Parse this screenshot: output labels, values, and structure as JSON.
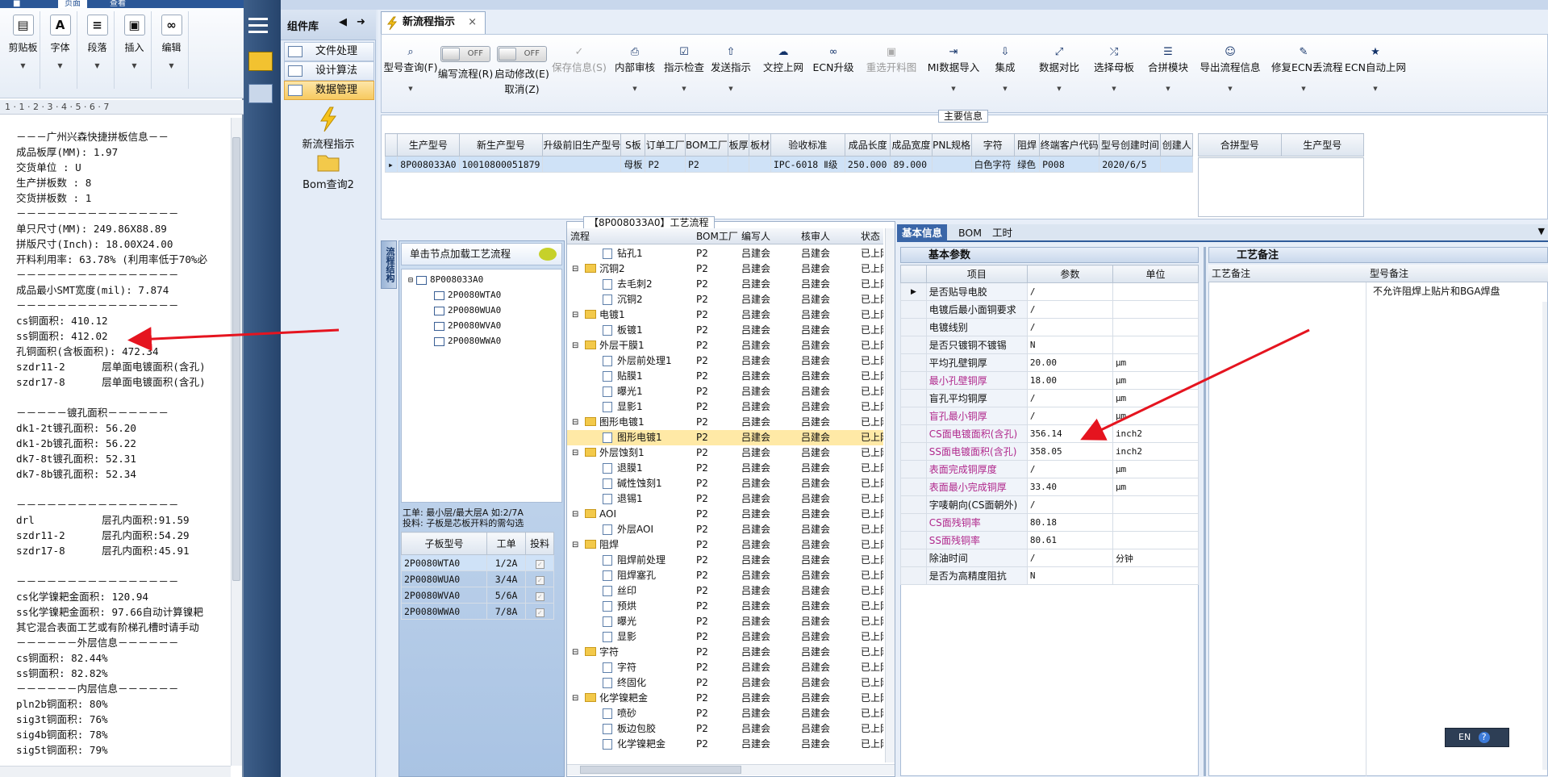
{
  "left_window": {
    "tabs": [
      "页面",
      "查看"
    ],
    "ribbon": [
      {
        "label": "剪贴板",
        "icon": "clipboard-icon"
      },
      {
        "label": "字体",
        "icon": "font-icon"
      },
      {
        "label": "段落",
        "icon": "paragraph-icon"
      },
      {
        "label": "插入",
        "icon": "insert-image-icon"
      },
      {
        "label": "编辑",
        "icon": "binoculars-icon"
      }
    ],
    "ruler": "1 · 1 · 2 · 3 · 4 · 5 · 6 · 7",
    "lines": [
      "－－－广州兴森快捷拼板信息－－",
      "成品板厚(MM): 1.97",
      "交货单位 : U",
      "生产拼板数 : 8",
      "交货拼板数 : 1",
      "－－－－－－－－－－－－－－－－",
      "单只尺寸(MM): 249.86X88.89",
      "拼版尺寸(Inch): 18.00X24.00",
      "开料利用率: 63.78% (利用率低于70%必",
      "－－－－－－－－－－－－－－－－",
      "成品最小SMT宽度(mil): 7.874",
      "－－－－－－－－－－－－－－－－",
      "cs铜面积: 410.12",
      "ss铜面积: 412.02",
      "孔铜面积(含板面积): 472.34",
      "szdr11-2      层单面电镀面积(含孔)",
      "szdr17-8      层单面电镀面积(含孔)",
      "",
      "－－－－－镀孔面积－－－－－－",
      "dk1-2t镀孔面积: 56.20",
      "dk1-2b镀孔面积: 56.22",
      "dk7-8t镀孔面积: 52.31",
      "dk7-8b镀孔面积: 52.34",
      "",
      "－－－－－－－－－－－－－－－－",
      "drl           层孔内面积:91.59",
      "szdr11-2      层孔内面积:54.29",
      "szdr17-8      层孔内面积:45.91",
      "",
      "－－－－－－－－－－－－－－－－",
      "cs化学镍耙金面积: 120.94",
      "ss化学镍耙金面积: 97.66自动计算镍耙",
      "其它混合表面工艺或有阶梯孔槽时请手动",
      "－－－－－－外层信息－－－－－－",
      "cs铜面积: 82.44%",
      "ss铜面积: 82.82%",
      "－－－－－－内层信息－－－－－－",
      "pln2b铜面积: 80%",
      "sig3t铜面积: 76%",
      "sig4b铜面积: 78%",
      "sig5t铜面积: 79%"
    ]
  },
  "component_lib": {
    "title": "组件库",
    "items": [
      "文件处理",
      "设计算法",
      "数据管理"
    ],
    "big_buttons": [
      "新流程指示",
      "Bom查询2"
    ]
  },
  "doc_tab": {
    "label": "新流程指示",
    "close": "×"
  },
  "toolbar": {
    "buttons": [
      {
        "label": "型号查询(F)",
        "icon": "search-icon",
        "disabled": false
      },
      {
        "label": "编写流程(R)",
        "icon": "",
        "disabled": false
      },
      {
        "label": "启动修改(E)",
        "sub": "取消(Z)",
        "icon": "",
        "disabled": false
      },
      {
        "label": "保存信息(S)",
        "icon": "check-icon",
        "disabled": true
      },
      {
        "label": "内部审核",
        "icon": "print-icon",
        "disabled": false
      },
      {
        "label": "指示检查",
        "icon": "checkbox-icon",
        "disabled": false
      },
      {
        "label": "发送指示",
        "icon": "upload-icon",
        "disabled": false
      },
      {
        "label": "文控上网",
        "icon": "cloud-upload-icon",
        "disabled": false
      },
      {
        "label": "ECN升级",
        "icon": "binoculars-icon",
        "disabled": false
      },
      {
        "label": "重选开料图",
        "icon": "image-icon",
        "disabled": true
      },
      {
        "label": "MI数据导入",
        "icon": "import-icon",
        "disabled": false
      },
      {
        "label": "集成",
        "icon": "download-icon",
        "disabled": false
      },
      {
        "label": "数据对比",
        "icon": "compare-icon",
        "disabled": false
      },
      {
        "label": "选择母板",
        "icon": "shuffle-icon",
        "disabled": false
      },
      {
        "label": "合拼模块",
        "icon": "list-icon",
        "disabled": false
      },
      {
        "label": "导出流程信息",
        "icon": "smile-icon",
        "disabled": false
      },
      {
        "label": "修复ECN丢流程",
        "icon": "wrench-icon",
        "disabled": false
      },
      {
        "label": "ECN自动上网",
        "icon": "star-icon",
        "disabled": false
      }
    ],
    "toggle_off": "OFF"
  },
  "main_info": {
    "caption": "主要信息",
    "columns": [
      "生产型号",
      "新生产型号",
      "升级前旧生产型号",
      "S板",
      "订单工厂",
      "BOM工厂",
      "板厚",
      "板材",
      "验收标准",
      "成品长度",
      "成品宽度",
      "PNL规格",
      "字符",
      "阻焊",
      "终端客户代码",
      "型号创建时间",
      "创建人"
    ],
    "row": [
      "8P008033A0",
      "10010800051879",
      "",
      "母板",
      "P2",
      "P2",
      "",
      "",
      "IPC-6018 Ⅱ级",
      "250.000",
      "89.000",
      "",
      "白色字符",
      "绿色",
      "P008",
      "2020/6/5",
      ""
    ],
    "side_columns": [
      "合拼型号",
      "生产型号"
    ]
  },
  "structure": {
    "vtab": "流程结构",
    "hint": "单击节点加载工艺流程",
    "root": "8P008033A0",
    "children": [
      "2P0080WTA0",
      "2P0080WUA0",
      "2P0080WVA0",
      "2P0080WWA0"
    ],
    "note1": "工单: 最小层/最大层A 如:2/7A",
    "note2": "投料: 子板是芯板开料的需勾选",
    "sub_columns": [
      "子板型号",
      "工单",
      "投料"
    ],
    "sub_rows": [
      [
        "2P0080WTA0",
        "1/2A"
      ],
      [
        "2P0080WUA0",
        "3/4A"
      ],
      [
        "2P0080WVA0",
        "5/6A"
      ],
      [
        "2P0080WWA0",
        "7/8A"
      ]
    ]
  },
  "flow": {
    "caption": "【8P008033A0】工艺流程",
    "columns": [
      "流程",
      "BOM工厂",
      "编写人",
      "核审人",
      "状态"
    ],
    "writer": "吕建会",
    "factory": "P2",
    "status": "已上网",
    "rows": [
      {
        "name": "钻孔1",
        "lvl": 2
      },
      {
        "name": "沉铜2",
        "lvl": 1
      },
      {
        "name": "去毛刺2",
        "lvl": 2
      },
      {
        "name": "沉铜2",
        "lvl": 2
      },
      {
        "name": "电镀1",
        "lvl": 1
      },
      {
        "name": "板镀1",
        "lvl": 2
      },
      {
        "name": "外层干膜1",
        "lvl": 1
      },
      {
        "name": "外层前处理1",
        "lvl": 2
      },
      {
        "name": "贴膜1",
        "lvl": 2
      },
      {
        "name": "曝光1",
        "lvl": 2
      },
      {
        "name": "显影1",
        "lvl": 2
      },
      {
        "name": "图形电镀1",
        "lvl": 1
      },
      {
        "name": "图形电镀1",
        "lvl": 2,
        "sel": true
      },
      {
        "name": "外层蚀刻1",
        "lvl": 1
      },
      {
        "name": "退膜1",
        "lvl": 2
      },
      {
        "name": "碱性蚀刻1",
        "lvl": 2
      },
      {
        "name": "退锡1",
        "lvl": 2
      },
      {
        "name": "AOI",
        "lvl": 1
      },
      {
        "name": "外层AOI",
        "lvl": 2
      },
      {
        "name": "阻焊",
        "lvl": 1
      },
      {
        "name": "阻焊前处理",
        "lvl": 2
      },
      {
        "name": "阻焊塞孔",
        "lvl": 2
      },
      {
        "name": "丝印",
        "lvl": 2
      },
      {
        "name": "预烘",
        "lvl": 2
      },
      {
        "name": "曝光",
        "lvl": 2
      },
      {
        "name": "显影",
        "lvl": 2
      },
      {
        "name": "字符",
        "lvl": 1
      },
      {
        "name": "字符",
        "lvl": 2
      },
      {
        "name": "终固化",
        "lvl": 2
      },
      {
        "name": "化学镍耙金",
        "lvl": 1
      },
      {
        "name": "喷砂",
        "lvl": 2
      },
      {
        "name": "板边包胶",
        "lvl": 2
      },
      {
        "name": "化学镍耙金",
        "lvl": 2
      }
    ]
  },
  "right_tabs": [
    "基本信息",
    "BOM",
    "工时"
  ],
  "basic_params": {
    "title": "基本参数",
    "columns": [
      "项目",
      "参数",
      "单位"
    ],
    "rows": [
      {
        "item": "是否贴导电胶",
        "val": "/",
        "unit": "",
        "hl": false
      },
      {
        "item": "电镀后最小面铜要求",
        "val": "/",
        "unit": "",
        "hl": false
      },
      {
        "item": "电镀线别",
        "val": "/",
        "unit": "",
        "hl": false
      },
      {
        "item": "是否只镀铜不镀锡",
        "val": "N",
        "unit": "",
        "hl": false
      },
      {
        "item": "平均孔壁铜厚",
        "val": "20.00",
        "unit": "μm",
        "hl": false
      },
      {
        "item": "最小孔壁铜厚",
        "val": "18.00",
        "unit": "μm",
        "hl": true
      },
      {
        "item": "盲孔平均铜厚",
        "val": "/",
        "unit": "μm",
        "hl": false
      },
      {
        "item": "盲孔最小铜厚",
        "val": "/",
        "unit": "μm",
        "hl": true
      },
      {
        "item": "CS面电镀面积(含孔)",
        "val": "356.14",
        "unit": "inch2",
        "hl": true
      },
      {
        "item": "SS面电镀面积(含孔)",
        "val": "358.05",
        "unit": "inch2",
        "hl": true
      },
      {
        "item": "表面完成铜厚度",
        "val": "/",
        "unit": "μm",
        "hl": true
      },
      {
        "item": "表面最小完成铜厚",
        "val": "33.40",
        "unit": "μm",
        "hl": true
      },
      {
        "item": "字唛朝向(CS面朝外)",
        "val": "/",
        "unit": "",
        "hl": false
      },
      {
        "item": "CS面残铜率",
        "val": "80.18",
        "unit": "",
        "hl": true
      },
      {
        "item": "SS面残铜率",
        "val": "80.61",
        "unit": "",
        "hl": true
      },
      {
        "item": "除油时间",
        "val": "/",
        "unit": "分钟",
        "hl": false
      },
      {
        "item": "是否为高精度阻抗",
        "val": "N",
        "unit": "",
        "hl": false
      }
    ]
  },
  "process_notes": {
    "title": "工艺备注",
    "columns": [
      "工艺备注",
      "型号备注"
    ],
    "model_note": "不允许阻焊上贴片和BGA焊盘"
  },
  "ime": {
    "label": "EN"
  },
  "colors": {
    "accent": "#2f5b9a",
    "arrow": "#e5141f",
    "highlight": "#b0288c",
    "selection": "#ffe9a6"
  }
}
